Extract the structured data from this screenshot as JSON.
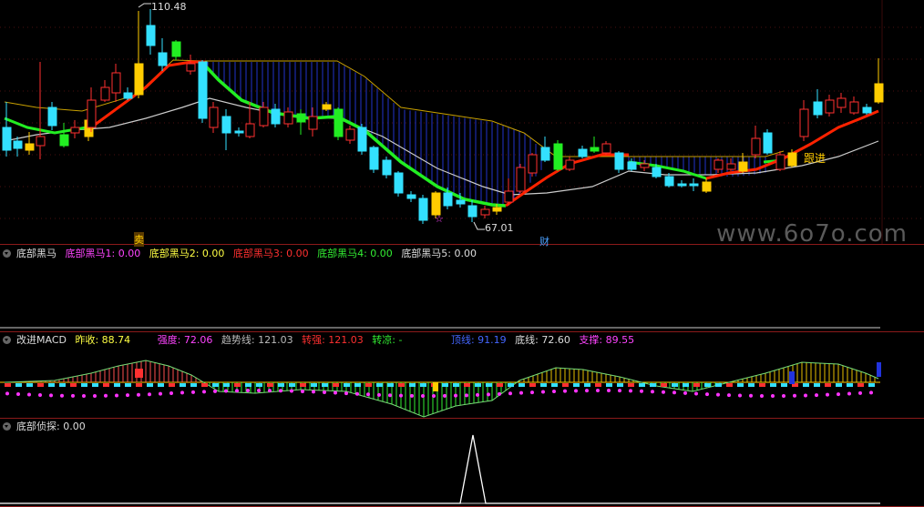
{
  "main_chart": {
    "high_label": "110.48",
    "low_label": "67.01",
    "marker_chars": {
      "sell_note": "卖",
      "caution": "☆",
      "wealth": "财",
      "follow": "跟进"
    },
    "watermark": "www.6o7o.com"
  },
  "panel_bottom_horse": {
    "title": "底部黑马",
    "items": [
      {
        "label": "底部黑马1: 0.00",
        "color": "#ff44ff"
      },
      {
        "label": "底部黑马2: 0.00",
        "color": "#ffff44"
      },
      {
        "label": "底部黑马3: 0.00",
        "color": "#ff3030"
      },
      {
        "label": "底部黑马4: 0.00",
        "color": "#33ee33"
      },
      {
        "label": "底部黑马5: 0.00",
        "color": "#dddddd"
      }
    ]
  },
  "panel_macd": {
    "title": "改进MACD",
    "items": [
      {
        "label": "昨收: 88.74",
        "color": "#ffff44"
      },
      {
        "label": "强度: 72.06",
        "color": "#ff44ff"
      },
      {
        "label": "趋势线: 121.03",
        "color": "#bbbbbb"
      },
      {
        "label": "转强: 121.03",
        "color": "#ff3030"
      },
      {
        "label": "转凉: -",
        "color": "#33ee33"
      },
      {
        "label": "顶线: 91.19",
        "color": "#4466ff"
      },
      {
        "label": "底线: 72.60",
        "color": "#dddddd"
      },
      {
        "label": "支撑: 89.55",
        "color": "#ff44ff"
      }
    ]
  },
  "panel_detect": {
    "title": "底部侦探",
    "value": ": 0.00"
  },
  "colors": {
    "up": "#ff3030",
    "down": "#33e0ff",
    "green_line": "#22ee22",
    "red_line": "#ff2200",
    "grid": "#8b1a1a",
    "band": "#2233cc",
    "yellow": "#ffcc00",
    "white_line": "#cccccc"
  }
}
